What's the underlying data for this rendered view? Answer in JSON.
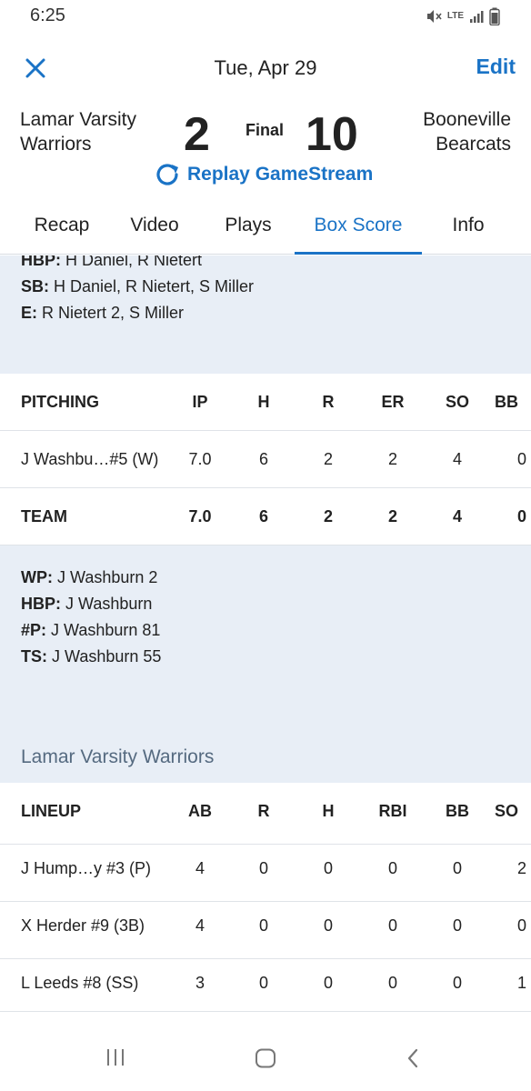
{
  "status": {
    "time": "6:25",
    "network": "LTE"
  },
  "header": {
    "date": "Tue, Apr 29",
    "edit_label": "Edit",
    "home_team": [
      "Lamar Varsity",
      "Warriors"
    ],
    "away_team": [
      "Booneville",
      "Bearcats"
    ],
    "home_score": "2",
    "away_score": "10",
    "status": "Final",
    "replay_label": "Replay GameStream"
  },
  "tabs": [
    "Recap",
    "Video",
    "Plays",
    "Box Score",
    "Info"
  ],
  "active_tab": "Box Score",
  "fielding_notes": [
    {
      "label": "HBP:",
      "value": " H Daniel, R Nietert"
    },
    {
      "label": "SB:",
      "value": " H Daniel, R Nietert, S Miller"
    },
    {
      "label": "E:",
      "value": " R Nietert 2, S Miller"
    }
  ],
  "pitching": {
    "headers": [
      "PITCHING",
      "IP",
      "H",
      "R",
      "ER",
      "SO",
      "BB"
    ],
    "rows": [
      [
        "J Washbu…#5 (W)",
        "7.0",
        "6",
        "2",
        "2",
        "4",
        "0"
      ]
    ],
    "team": [
      "TEAM",
      "7.0",
      "6",
      "2",
      "2",
      "4",
      "0"
    ]
  },
  "pitching_notes": [
    {
      "label": "WP:",
      "value": " J Washburn 2"
    },
    {
      "label": "HBP:",
      "value": " J Washburn"
    },
    {
      "label": "#P:",
      "value": " J Washburn 81"
    },
    {
      "label": "TS:",
      "value": " J Washburn 55"
    }
  ],
  "section_title": "Lamar Varsity Warriors",
  "lineup": {
    "headers": [
      "LINEUP",
      "AB",
      "R",
      "H",
      "RBI",
      "BB",
      "SO"
    ],
    "rows": [
      [
        "J Hump…y #3 (P)",
        "4",
        "0",
        "0",
        "0",
        "0",
        "2"
      ],
      [
        "X Herder #9 (3B)",
        "4",
        "0",
        "0",
        "0",
        "0",
        "0"
      ],
      [
        "L Leeds #8 (SS)",
        "3",
        "0",
        "0",
        "0",
        "0",
        "1"
      ]
    ]
  },
  "colors": {
    "accent": "#1a73c6",
    "panel": "#e8eef6",
    "section_title": "#556a80"
  }
}
